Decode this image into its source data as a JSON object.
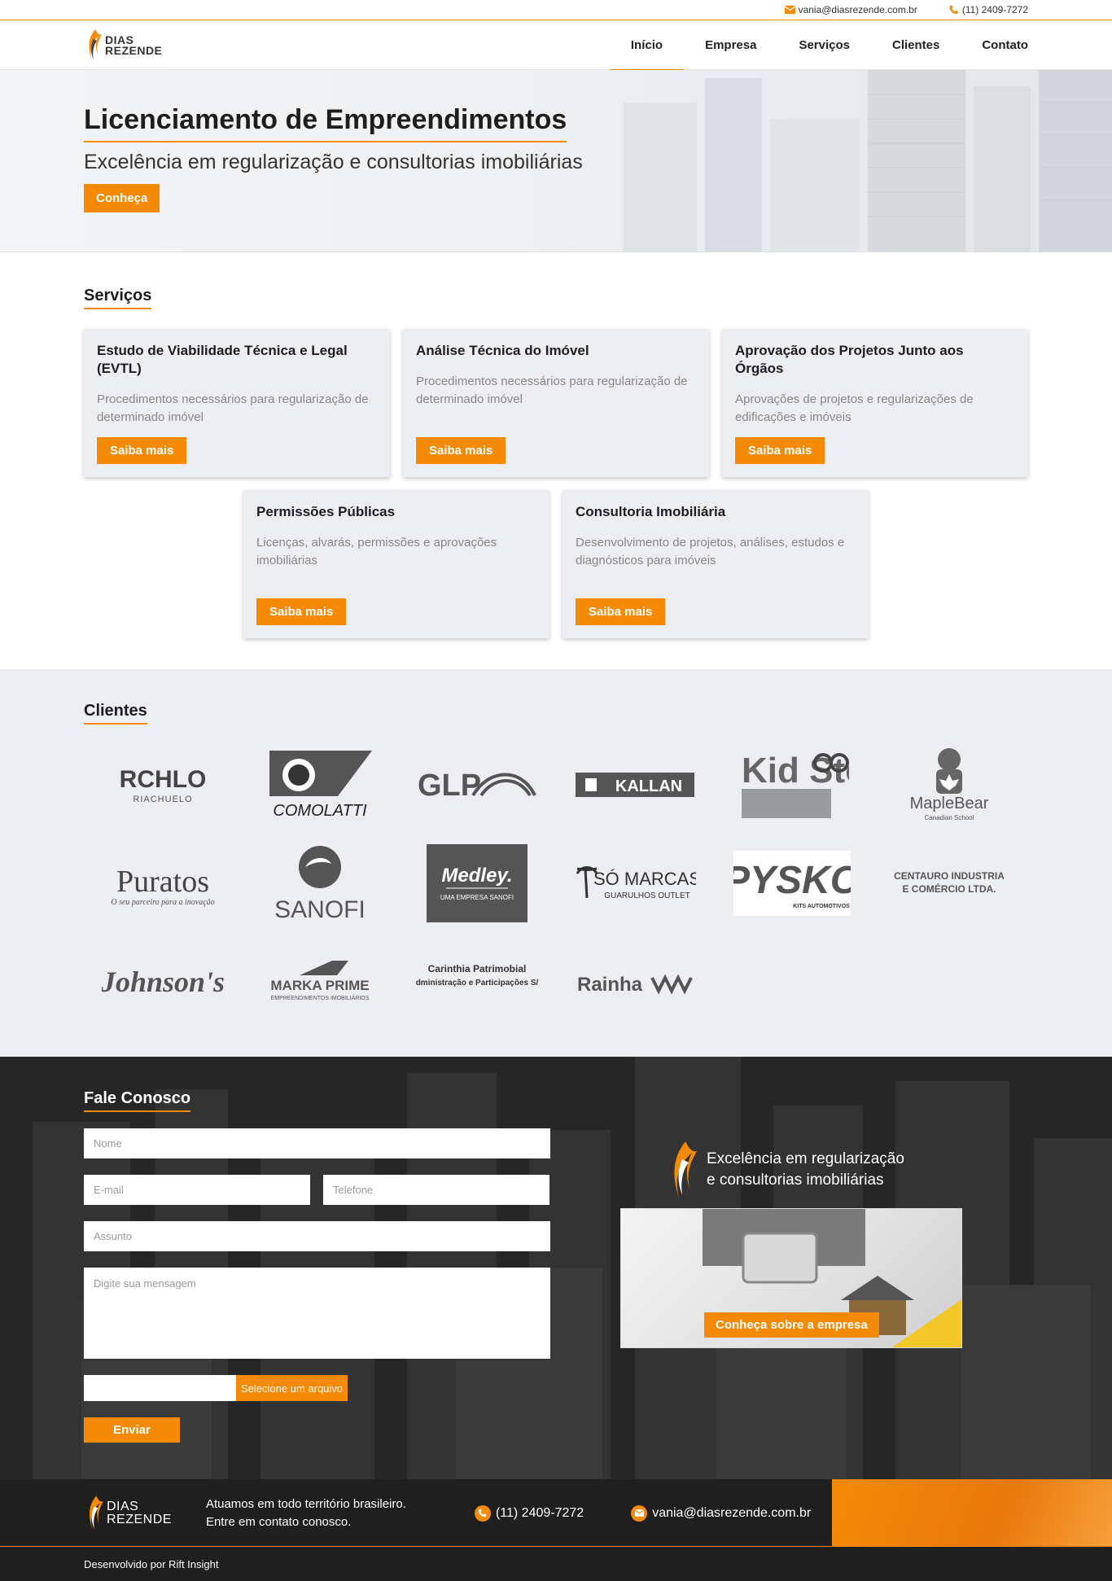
{
  "topbar": {
    "email": "vania@diasrezende.com.br",
    "phone": "(11) 2409-7272"
  },
  "brand": {
    "line1": "DIAS",
    "line2": "REZENDE",
    "accent": "#f58a07"
  },
  "nav": {
    "items": [
      "Início",
      "Empresa",
      "Serviços",
      "Clientes",
      "Contato"
    ]
  },
  "hero": {
    "title": "Licenciamento de Empreendimentos",
    "subtitle": "Excelência em regularização e consultorias imobiliárias",
    "button": "Conheça"
  },
  "services": {
    "title": "Serviços",
    "cards": [
      {
        "title": "Estudo de Viabilidade Técnica e Legal (EVTL)",
        "text": "Procedimentos necessários para regularização de determinado imóvel",
        "button": "Saiba mais"
      },
      {
        "title": "Análise Técnica do Imóvel",
        "text": "Procedimentos necessários para regularização de determinado imóvel",
        "button": "Saiba mais"
      },
      {
        "title": "Aprovação dos Projetos Junto aos Órgãos",
        "text": "Aprovações de projetos e regularizações de edificações e imóveis",
        "button": "Saiba mais"
      },
      {
        "title": "Permissões Públicas",
        "text": "Licenças, alvarás, permissões e aprovações imobiliárias",
        "button": "Saiba mais"
      },
      {
        "title": "Consultoria Imobiliária",
        "text": "Desenvolvimento de projetos, análises, estudos e diagnósticos para imóveis",
        "button": "Saiba mais"
      }
    ]
  },
  "clients": {
    "title": "Clientes",
    "logos": [
      {
        "name": "RCHLO",
        "sub": "RIACHUELO"
      },
      {
        "name": "COMOLATTI",
        "sub": ""
      },
      {
        "name": "GLP",
        "sub": ""
      },
      {
        "name": "KALLAN",
        "sub": ""
      },
      {
        "name": "Kid Stok",
        "sub": ""
      },
      {
        "name": "MapleBear",
        "sub": "Canadian School"
      },
      {
        "name": "Puratos",
        "sub": "O seu parceiro para a inovação"
      },
      {
        "name": "SANOFI",
        "sub": ""
      },
      {
        "name": "Medley.",
        "sub": "UMA EMPRESA SANOFI"
      },
      {
        "name": "SÓ MARCAS",
        "sub": "GUARULHOS OUTLET"
      },
      {
        "name": "PYSKO",
        "sub": "KITS AUTOMOTIVOS"
      },
      {
        "name": "CENTAURO INDUSTRIA",
        "sub": "E COMÉRCIO LTDA."
      },
      {
        "name": "Johnson's",
        "sub": ""
      },
      {
        "name": "MARKA PRIME",
        "sub": "EMPREENDIMENTOS IMOBILIÁRIOS"
      },
      {
        "name": "Carinthia Patrimobial",
        "sub": "Administração e Participações S/A"
      },
      {
        "name": "Rainha",
        "sub": ""
      }
    ]
  },
  "contact": {
    "title": "Fale Conosco",
    "placeholders": {
      "name": "Nome",
      "email": "E-mail",
      "phone": "Telefone",
      "subject": "Assunto",
      "message": "Digite sua mensagem"
    },
    "file_button": "Selecione um arquivo",
    "send": "Enviar",
    "promo_line1": "Excelência em regularização",
    "promo_line2": "e consultorias imobiliárias",
    "promo_button": "Conheça sobre a empresa"
  },
  "footer": {
    "line1": "Atuamos em todo território brasileiro.",
    "line2": "Entre em contato conosco.",
    "phone": "(11) 2409-7272",
    "email": "vania@diasrezende.com.br",
    "credits": "Desenvolvido por Rift Insight"
  }
}
